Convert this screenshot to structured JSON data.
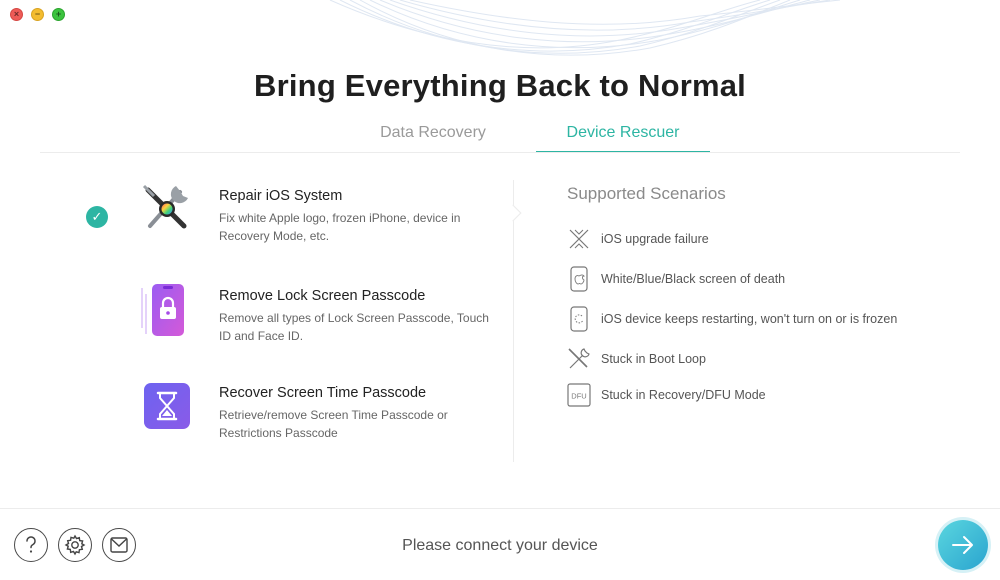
{
  "window": {
    "controls": [
      "close",
      "minimize",
      "maximize"
    ]
  },
  "header": {
    "title": "Bring Everything Back to Normal"
  },
  "tabs": [
    {
      "label": "Data Recovery",
      "active": false
    },
    {
      "label": "Device Rescuer",
      "active": true
    }
  ],
  "features": [
    {
      "name": "Repair iOS System",
      "description": "Fix white Apple logo, frozen iPhone, device in Recovery Mode, etc.",
      "icon": "wrench-screwdriver-icon",
      "selected": true
    },
    {
      "name": "Remove Lock Screen Passcode",
      "description": "Remove all types of Lock Screen Passcode, Touch ID and Face ID.",
      "icon": "phone-lock-icon",
      "selected": false
    },
    {
      "name": "Recover Screen Time Passcode",
      "description": "Retrieve/remove Screen Time Passcode or Restrictions Passcode",
      "icon": "hourglass-icon",
      "selected": false
    }
  ],
  "scenarios": {
    "title": "Supported Scenarios",
    "items": [
      {
        "text": "iOS upgrade failure",
        "icon": "broken-x-icon"
      },
      {
        "text": "White/Blue/Black screen of death",
        "icon": "phone-apple-icon"
      },
      {
        "text": "iOS device keeps restarting, won't turn on or is frozen",
        "icon": "phone-restart-icon"
      },
      {
        "text": "Stuck in Boot Loop",
        "icon": "tools-icon"
      },
      {
        "text": "Stuck in Recovery/DFU Mode",
        "icon": "dfu-icon",
        "icon_label": "DFU"
      }
    ]
  },
  "footer": {
    "status": "Please connect your device",
    "help_icon": "question-icon",
    "settings_icon": "gear-icon",
    "mail_icon": "mail-icon",
    "next_icon": "arrow-right-icon"
  },
  "colors": {
    "accent": "#2db5a3",
    "next_button": "#3bbcd8",
    "close": "#ee5b57",
    "minimize": "#f3bc2f",
    "maximize": "#3cc33f"
  }
}
